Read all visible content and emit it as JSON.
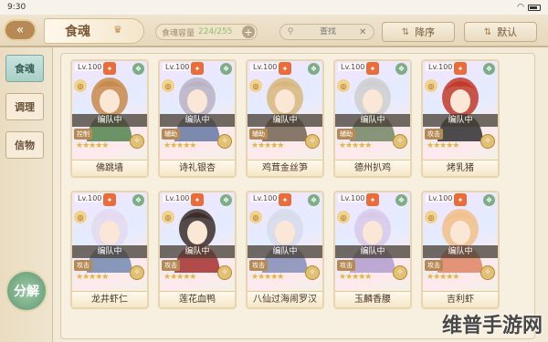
{
  "status_bar": {
    "time": "9:30"
  },
  "header": {
    "title": "食魂",
    "capacity_label": "食魂容量",
    "capacity_value": "224/255",
    "capacity_plus": "+",
    "search_placeholder": "查找",
    "sort_desc_label": "降序",
    "sort_default_label": "默认"
  },
  "sidebar": {
    "tabs": [
      {
        "label": "食魂",
        "active": true
      },
      {
        "label": "调理",
        "active": false
      },
      {
        "label": "信物",
        "active": false
      }
    ],
    "decompose_label": "分解"
  },
  "cards": [
    {
      "level": "Lv.100",
      "name": "佛跳墙",
      "status": "编队中",
      "attr": "控制",
      "stars": "★★★★★",
      "colors": [
        "#c98a4a",
        "#5b8a56"
      ]
    },
    {
      "level": "Lv.100",
      "name": "诗礼银杏",
      "status": "编队中",
      "attr": "辅助",
      "stars": "★★★★★",
      "colors": [
        "#b9b3c4",
        "#6f7fa8"
      ]
    },
    {
      "level": "Lv.100",
      "name": "鸡茸金丝笋",
      "status": "编队中",
      "attr": "辅助",
      "stars": "★★★★★",
      "colors": [
        "#d9b77a",
        "#7b6b5a"
      ]
    },
    {
      "level": "Lv.100",
      "name": "德州扒鸡",
      "status": "编队中",
      "attr": "辅助",
      "stars": "★★★★★",
      "colors": [
        "#cfcfcf",
        "#7a8c6a"
      ]
    },
    {
      "level": "Lv.100",
      "name": "烤乳猪",
      "status": "编队中",
      "attr": "攻击",
      "stars": "★★★★★",
      "colors": [
        "#c23a2a",
        "#3a3a3a"
      ]
    },
    {
      "level": "Lv.100",
      "name": "龙井虾仁",
      "status": "编队中",
      "attr": "攻击",
      "stars": "★★★★★",
      "colors": [
        "#e4d9ef",
        "#7a8fb4"
      ]
    },
    {
      "level": "Lv.100",
      "name": "莲花血鸭",
      "status": "编队中",
      "attr": "攻击",
      "stars": "★★★★★",
      "colors": [
        "#3a2e2a",
        "#a83a3a"
      ]
    },
    {
      "level": "Lv.100",
      "name": "八仙过海闹罗汉",
      "status": "编队中",
      "attr": "攻击",
      "stars": "★★★★★",
      "colors": [
        "#d7dbea",
        "#8894ba"
      ]
    },
    {
      "level": "Lv.100",
      "name": "玉麟香腰",
      "status": "编队中",
      "attr": "攻击",
      "stars": "★★★★★",
      "colors": [
        "#d8c9ea",
        "#b6a2cf"
      ]
    },
    {
      "level": "Lv.100",
      "name": "吉利虾",
      "status": "编队中",
      "attr": "攻击",
      "stars": "★★★★★",
      "colors": [
        "#f2c08a",
        "#e08a6a"
      ]
    }
  ],
  "watermark": "维普手游网"
}
